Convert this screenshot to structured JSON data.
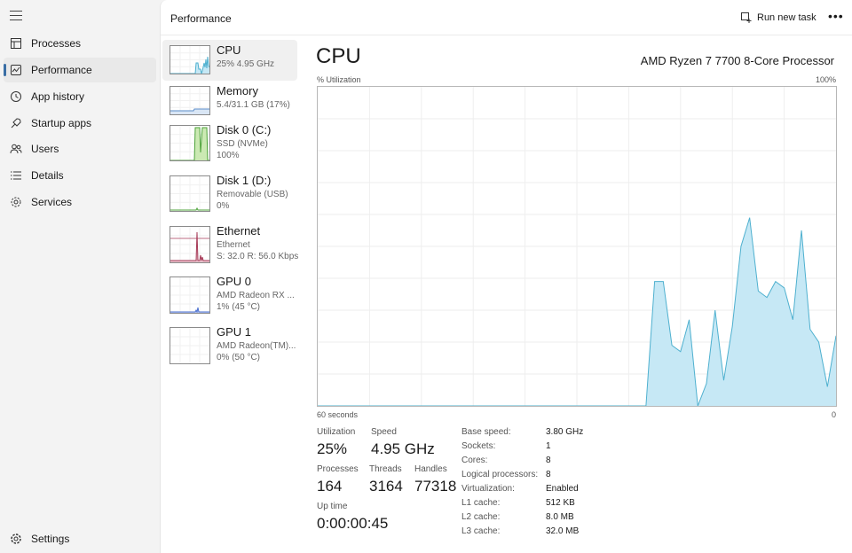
{
  "nav": {
    "items": [
      {
        "label": "Processes",
        "icon": "processes-icon"
      },
      {
        "label": "Performance",
        "icon": "performance-icon",
        "active": true
      },
      {
        "label": "App history",
        "icon": "app-history-icon"
      },
      {
        "label": "Startup apps",
        "icon": "startup-apps-icon"
      },
      {
        "label": "Users",
        "icon": "users-icon"
      },
      {
        "label": "Details",
        "icon": "details-icon"
      },
      {
        "label": "Services",
        "icon": "services-icon"
      }
    ],
    "settings_label": "Settings"
  },
  "header": {
    "title": "Performance",
    "run_task_label": "Run new task",
    "more_label": "•••"
  },
  "resources": [
    {
      "name": "CPU",
      "line2": "25%  4.95 GHz",
      "line3": ""
    },
    {
      "name": "Memory",
      "line2": "5.4/31.1 GB (17%)",
      "line3": ""
    },
    {
      "name": "Disk 0 (C:)",
      "line2": "SSD (NVMe)",
      "line3": "100%"
    },
    {
      "name": "Disk 1 (D:)",
      "line2": "Removable (USB)",
      "line3": "0%"
    },
    {
      "name": "Ethernet",
      "line2": "Ethernet",
      "line3": "S: 32.0  R: 56.0 Kbps"
    },
    {
      "name": "GPU 0",
      "line2": "AMD Radeon RX ...",
      "line3": "1%  (45 °C)"
    },
    {
      "name": "GPU 1",
      "line2": "AMD Radeon(TM)...",
      "line3": "0%  (50 °C)"
    }
  ],
  "detail": {
    "title": "CPU",
    "processor": "AMD Ryzen 7 7700 8-Core Processor",
    "y_label": "% Utilization",
    "y_max_label": "100%",
    "x_left_label": "60 seconds",
    "x_right_label": "0",
    "stats": {
      "utilization_label": "Utilization",
      "utilization": "25%",
      "speed_label": "Speed",
      "speed": "4.95 GHz",
      "processes_label": "Processes",
      "processes": "164",
      "threads_label": "Threads",
      "threads": "3164",
      "handles_label": "Handles",
      "handles": "77318",
      "uptime_label": "Up time",
      "uptime": "0:00:00:45"
    },
    "specs": [
      {
        "k": "Base speed:",
        "v": "3.80 GHz"
      },
      {
        "k": "Sockets:",
        "v": "1"
      },
      {
        "k": "Cores:",
        "v": "8"
      },
      {
        "k": "Logical processors:",
        "v": "8"
      },
      {
        "k": "Virtualization:",
        "v": "Enabled"
      },
      {
        "k": "L1 cache:",
        "v": "512 KB"
      },
      {
        "k": "L2 cache:",
        "v": "8.0 MB"
      },
      {
        "k": "L3 cache:",
        "v": "32.0 MB"
      }
    ]
  },
  "chart_data": {
    "type": "area",
    "xlim": [
      60,
      0
    ],
    "ylim": [
      0,
      100
    ],
    "grid": true,
    "x": [
      60,
      59,
      58,
      57,
      56,
      55,
      54,
      53,
      52,
      51,
      50,
      49,
      48,
      47,
      46,
      45,
      44,
      43,
      42,
      41,
      40,
      39,
      38,
      37,
      36,
      35,
      34,
      33,
      32,
      31,
      30,
      29,
      28,
      27,
      26,
      25,
      24,
      23,
      22,
      21,
      20,
      19,
      18,
      17,
      16,
      15,
      14,
      13,
      12,
      11,
      10,
      9,
      8,
      7,
      6,
      5,
      4,
      3,
      2,
      1,
      0
    ],
    "values": [
      0,
      0,
      0,
      0,
      0,
      0,
      0,
      0,
      0,
      0,
      0,
      0,
      0,
      0,
      0,
      0,
      0,
      0,
      0,
      0,
      0,
      0,
      0,
      0,
      0,
      0,
      0,
      0,
      0,
      0,
      0,
      0,
      0,
      0,
      0,
      0,
      0,
      0,
      0,
      39,
      39,
      19,
      17,
      27,
      0,
      7,
      30,
      8,
      25,
      50,
      59,
      36,
      34,
      39,
      37,
      27,
      55,
      24,
      20,
      6,
      22
    ],
    "color": "#4eb0cf",
    "fill": "#c6e8f5"
  }
}
